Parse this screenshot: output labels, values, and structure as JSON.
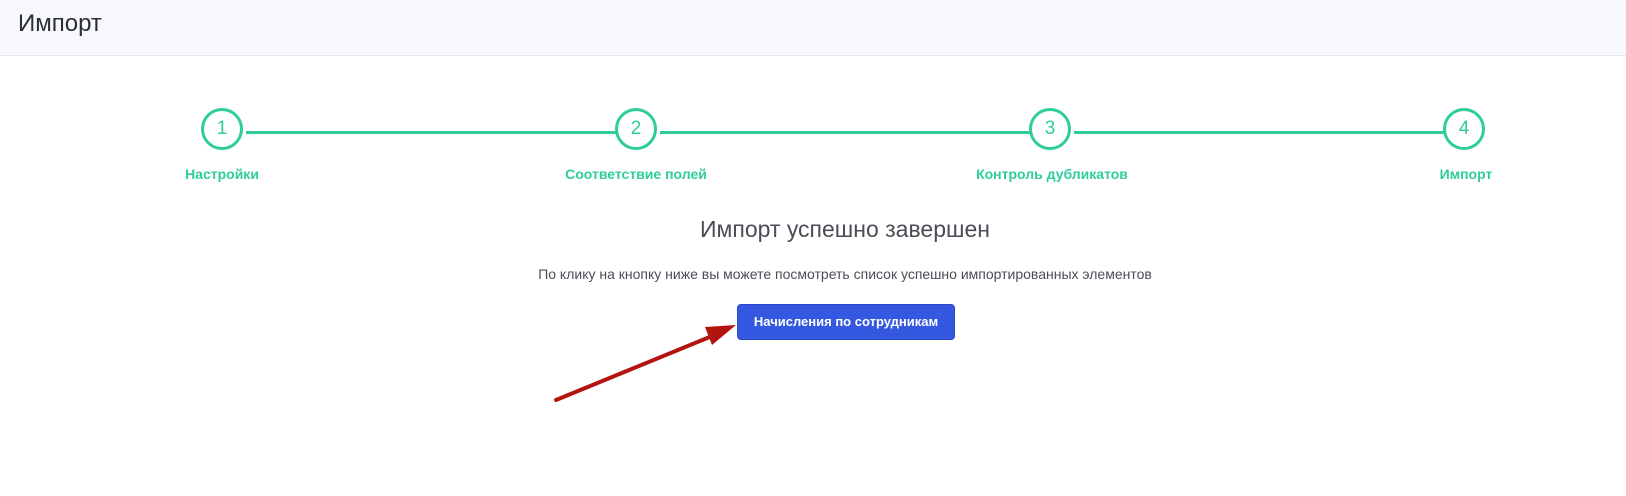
{
  "header": {
    "title": "Импорт"
  },
  "stepper": {
    "color": "#2fcc9e",
    "steps": [
      {
        "number": "1",
        "label": "Настройки"
      },
      {
        "number": "2",
        "label": "Соответствие полей"
      },
      {
        "number": "3",
        "label": "Контроль дубликатов"
      },
      {
        "number": "4",
        "label": "Импорт"
      }
    ]
  },
  "result": {
    "title": "Импорт успешно завершен",
    "description": "По клику на кнопку ниже вы можете посмотреть список успешно импортированных элементов",
    "button_label": "Начисления по сотрудникам",
    "button_color": "#3558e0"
  },
  "annotation": {
    "arrow_color": "#b3140f"
  }
}
